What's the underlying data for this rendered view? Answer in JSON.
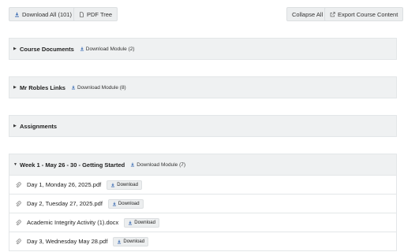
{
  "toolbar": {
    "download_all_label": "Download All (101)",
    "pdf_tree_label": "PDF Tree",
    "collapse_all_label": "Collapse All",
    "export_label": "Export Course Content"
  },
  "modules": [
    {
      "title": "Course Documents",
      "download_label": "Download Module (2)",
      "state": "collapsed"
    },
    {
      "title": "Mr Robles Links",
      "download_label": "Download Module (8)",
      "state": "collapsed"
    },
    {
      "title": "Assignments",
      "download_label": "",
      "state": "collapsed"
    },
    {
      "title": "Week 1 - May 26 - 30 - Getting Started",
      "download_label": "Download Module (7)",
      "state": "expanded"
    }
  ],
  "files": [
    {
      "name": "Day 1, Monday 26, 2025.pdf",
      "download_label": "Download"
    },
    {
      "name": "Day 2, Tuesday 27, 2025.pdf",
      "download_label": "Download"
    },
    {
      "name": "Academic Integrity Activity (1).docx",
      "download_label": "Download"
    },
    {
      "name": "Day 3, Wednesday May 28.pdf",
      "download_label": "Download"
    }
  ],
  "icons": {
    "download": "download-icon",
    "pdf": "file-pdf-icon",
    "export": "external-link-icon",
    "attachment": "paperclip-icon",
    "caret_collapsed": "caret-right-icon",
    "caret_expanded": "caret-down-icon"
  },
  "colors": {
    "accent": "#3f6fb5",
    "panel": "#eff1f2"
  }
}
